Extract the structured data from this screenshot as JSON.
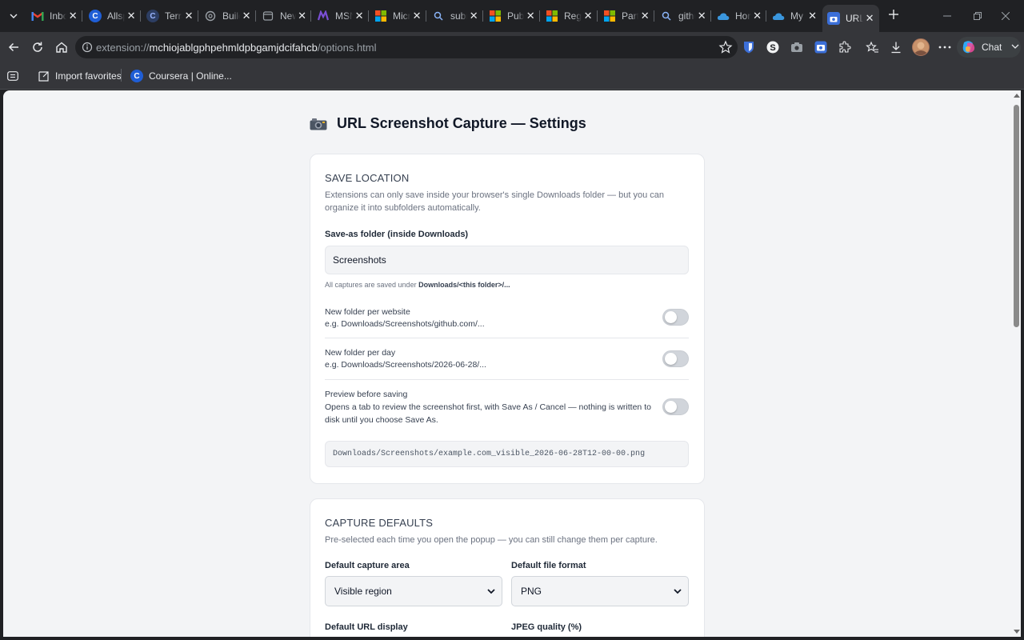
{
  "tabs": [
    {
      "title": "Inbox",
      "icon": "gmail-icon"
    },
    {
      "title": "Allspring",
      "icon": "coursera-icon"
    },
    {
      "title": "Terraform",
      "icon": "coursera-icon"
    },
    {
      "title": "Build",
      "icon": "openai-icon"
    },
    {
      "title": "New tab",
      "icon": "newtab-icon"
    },
    {
      "title": "MSN",
      "icon": "msn-icon"
    },
    {
      "title": "Microsoft",
      "icon": "microsoft-icon"
    },
    {
      "title": "submit",
      "icon": "search-icon"
    },
    {
      "title": "Publish",
      "icon": "microsoft-icon"
    },
    {
      "title": "Register",
      "icon": "microsoft-icon"
    },
    {
      "title": "Partner",
      "icon": "microsoft-icon"
    },
    {
      "title": "github",
      "icon": "search-icon"
    },
    {
      "title": "Home",
      "icon": "onedrive-icon"
    },
    {
      "title": "My files",
      "icon": "onedrive-icon"
    },
    {
      "title": "URL Screenshot",
      "icon": "camera-icon",
      "active": true
    }
  ],
  "address": {
    "scheme": "extension://",
    "host": "mchiojablgphpehmldpbgamjdcifahcb",
    "path": "/options.html"
  },
  "toolbar": {
    "chat_label": "Chat"
  },
  "bookmarks": [
    {
      "label": "Import favorites",
      "icon": "import-icon"
    },
    {
      "label": "Coursera | Online...",
      "icon": "coursera-icon"
    }
  ],
  "page": {
    "title": "URL Screenshot Capture — Settings",
    "save_location": {
      "heading": "Save location",
      "description": "Extensions can only save inside your browser's single Downloads folder — but you can organize it into subfolders automatically.",
      "folder_label": "Save-as folder (inside Downloads)",
      "folder_value": "Screenshots",
      "folder_hint_prefix": "All captures are saved under ",
      "folder_hint_path": "Downloads/<this folder>/...",
      "options": [
        {
          "title": "New folder per website",
          "desc": "e.g. Downloads/Screenshots/github.com/...",
          "enabled": false
        },
        {
          "title": "New folder per day",
          "desc": "e.g. Downloads/Screenshots/2026-06-28/...",
          "enabled": false
        },
        {
          "title": "Preview before saving",
          "desc": "Opens a tab to review the screenshot first, with Save As / Cancel — nothing is written to disk until you choose Save As.",
          "enabled": false
        }
      ],
      "path_preview": "Downloads/Screenshots/example.com_visible_2026-06-28T12-00-00.png"
    },
    "capture_defaults": {
      "heading": "Capture defaults",
      "description": "Pre-selected each time you open the popup — you can still change them per capture.",
      "area_label": "Default capture area",
      "area_value": "Visible region",
      "format_label": "Default file format",
      "format_value": "PNG",
      "url_display_label": "Default URL display",
      "jpeg_quality_label": "JPEG quality (%)"
    }
  },
  "colors": {
    "browser_frame": "#202124",
    "toolbar": "#35363a",
    "page_bg": "#f3f4f6",
    "card_bg": "#ffffff",
    "toggle_off": "#d1d5db"
  }
}
